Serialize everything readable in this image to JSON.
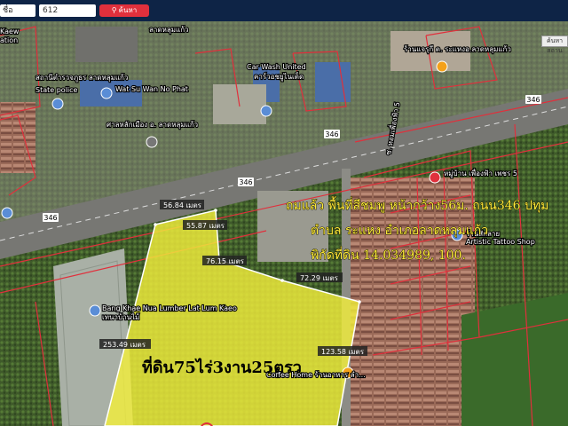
{
  "toolbar": {
    "select_value": "ชื่อ",
    "search_value": "612",
    "search_button_label": "ค้นหา"
  },
  "map_control_label": "ค้นหาสถาน",
  "road_number_labels": [
    "346",
    "346",
    "346",
    "346",
    "346"
  ],
  "places": {
    "police_name_th": "สถานีตำรวจภูธร ลาดหลุมแก้ว",
    "police_name_en": "State police",
    "temple": "Wat Su Wan No Phat",
    "shrine": "ศาลหลักเมือง อ. ลาดหลุมแก้ว",
    "car_wash": "Car Wash United",
    "car_wash_th": "คาร์วอชยูไนเต็ด",
    "top_left_fragment": "ลาดหลุมแก้ว",
    "left_fragment_1": "Kaew",
    "left_fragment_2": "ation",
    "shop_top_right": "ร้านแจรุกี ต. ระแหงอ.ลาดหลุมแก้ว",
    "village": "หมู่บ้าน เพื่องฟ้า เพชร 5",
    "soi_label": "ซ. หอมเพื่องฟ้า 5",
    "lumber": "Bang Khae Nua Lumber Lat Lum Kaeo",
    "lumber_th": "เทนาบ้านไม้",
    "tattoo": "Artistic Tattoo Shop",
    "tattoo_th": "ร้านสักลาย",
    "coffee": "Coffee Home ร้านอาหาร ลำ..."
  },
  "measurements": [
    {
      "label": "56.84 เมตร"
    },
    {
      "label": "55.87 เมตร"
    },
    {
      "label": "76.15 เมตร"
    },
    {
      "label": "72.29 เมตร"
    },
    {
      "label": "253.49 เมตร"
    },
    {
      "label": "123.58 เมตร"
    }
  ],
  "overlay_text": {
    "line1": "ถมแล้ว พื้นที่สีชมพู หน้ากว้าง56ม. ถนน346 ปทุม",
    "line2": "ตำบล ระแหง อำเภอลาดหลุมแก้ว",
    "line3": "พิกัดที่ดิน 14.034989, 100.",
    "area_label": "ที่ดิน75ไร่3งาน25ตรว"
  },
  "colors": {
    "parcel_fill": "#f2ee3c",
    "parcel_border": "#ffffff",
    "cadastral_lines": "#e0303c",
    "toolbar_bg": "#0e2446",
    "search_button": "#e0303c"
  },
  "icons": [
    "search-icon",
    "map-pin-icon",
    "location-marker-icon"
  ]
}
